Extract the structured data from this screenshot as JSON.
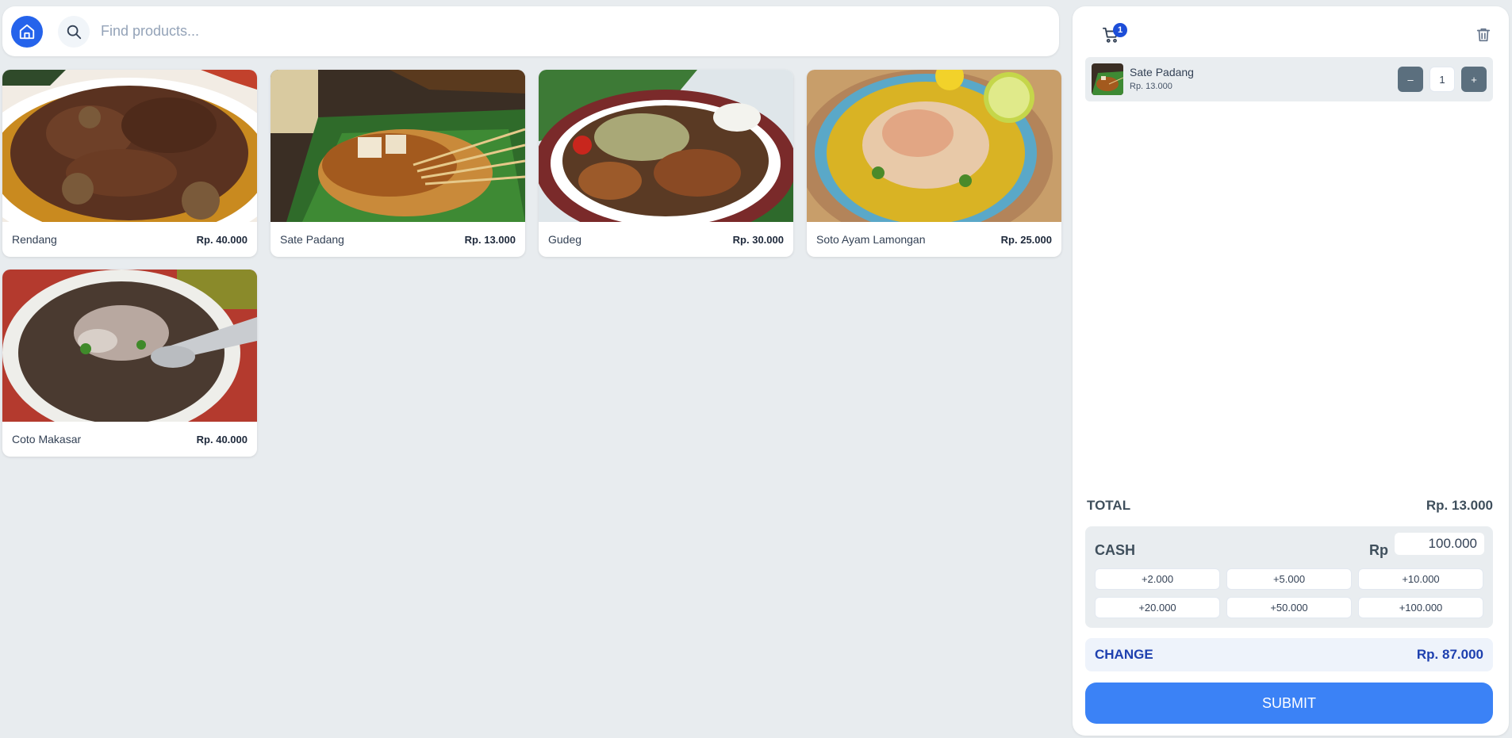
{
  "search": {
    "placeholder": "Find products..."
  },
  "icons": {
    "home": "home-icon",
    "search": "search-icon",
    "cart": "cart-icon",
    "trash": "trash-icon"
  },
  "colors": {
    "accent": "#2563eb",
    "submit": "#3b82f6",
    "background": "#e8ecef",
    "change_text": "#1e40af"
  },
  "products": [
    {
      "name": "Rendang",
      "price": "Rp. 40.000"
    },
    {
      "name": "Sate Padang",
      "price": "Rp. 13.000"
    },
    {
      "name": "Gudeg",
      "price": "Rp. 30.000"
    },
    {
      "name": "Soto Ayam Lamongan",
      "price": "Rp. 25.000"
    },
    {
      "name": "Coto Makasar",
      "price": "Rp. 40.000"
    }
  ],
  "cart": {
    "count": "1",
    "items": [
      {
        "name": "Sate Padang",
        "price": "Rp. 13.000",
        "qty": "1",
        "minus": "–",
        "plus": "+"
      }
    ]
  },
  "summary": {
    "total_label": "TOTAL",
    "total_value": "Rp. 13.000",
    "cash_label": "CASH",
    "cash_currency": "Rp",
    "cash_value": "100.000",
    "quick_amounts": [
      "+2.000",
      "+5.000",
      "+10.000",
      "+20.000",
      "+50.000",
      "+100.000"
    ],
    "change_label": "CHANGE",
    "change_value": "Rp. 87.000",
    "submit_label": "SUBMIT"
  }
}
